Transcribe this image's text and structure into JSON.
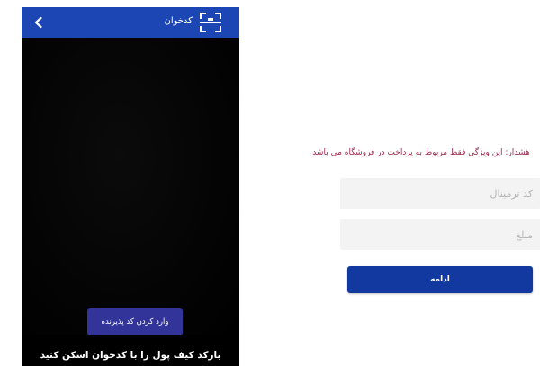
{
  "scanner": {
    "header": {
      "title": "کدخوان",
      "back_icon": "chevron-left-icon",
      "scan_icon": "qr-scan-icon",
      "color": "#1b46b3"
    },
    "enter_code_label": "وارد کردن کد پذیرنده",
    "instruction": "بارکد کیف پول را با کدخوان اسکن کنید",
    "button_color": "#33349a"
  },
  "form": {
    "warning": "هشدار: این ویژگی فقط مربوط به پرداخت در فروشگاه می باشد",
    "warning_color": "#a0294c",
    "terminal_placeholder": "کد ترمینال",
    "amount_placeholder": "مبلغ",
    "continue_label": "ادامه",
    "button_color": "#12399f"
  }
}
